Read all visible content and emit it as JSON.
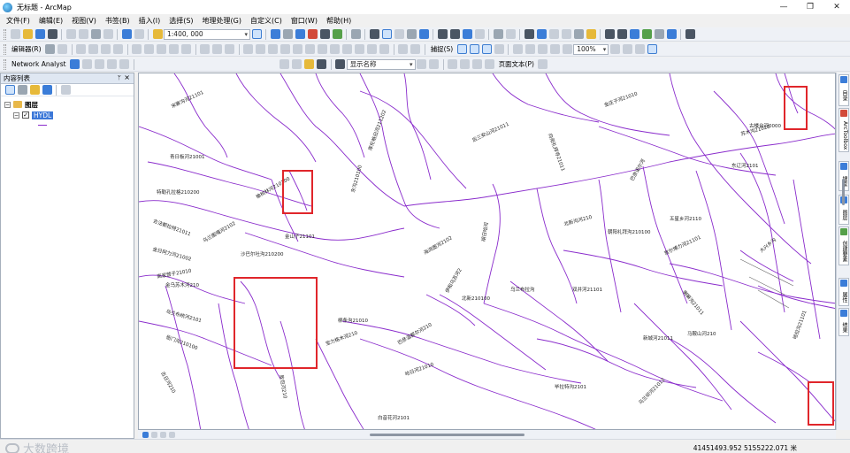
{
  "window": {
    "title": "无标题 - ArcMap",
    "minimize": "—",
    "restore": "❐",
    "close": "✕"
  },
  "menu": [
    "文件(F)",
    "编辑(E)",
    "视图(V)",
    "书签(B)",
    "插入(I)",
    "选择(S)",
    "地理处理(G)",
    "自定义(C)",
    "窗口(W)",
    "帮助(H)"
  ],
  "toolbar": {
    "scale": "1:400, 000",
    "editor": "编辑器(R)",
    "snapping": "捕捉(S)",
    "network_analyst": "Network Analyst",
    "display_name": "显示名称",
    "page_text": "页面文本(P)",
    "zoom_percent": "100%"
  },
  "toc": {
    "title": "内容列表",
    "pin": "ᛘ",
    "close": "×",
    "group": "图层",
    "layer": "HYDL",
    "expand": "−",
    "check": "✓"
  },
  "map": {
    "labels": [
      "宋寨沟河21101",
      "库伦格旧河211202",
      "古楼台河0000",
      "金庄子河21010",
      "后三安山河21011",
      "向阳礼拜寺21011",
      "青日板河21001",
      "特勒孔拉格210200",
      "合法都拉特21011",
      "乌兰图嘎河2102",
      "金山子21101",
      "金日阿力河21002",
      "高家营子21010",
      "北新210100",
      "金乌苏木河210",
      "北新沟河210",
      "沙巴尔吐沟210200",
      "朝阳礼拜沟210100",
      "东辽河2101",
      "宫尔博力河21101",
      "五星乡河2110",
      "乌兰布拉沟",
      "宝力格木河210",
      "柳条沟21010",
      "巴彦温都尔河210",
      "海流图河2102",
      "毕拉特沟2101",
      "新城河21011",
      "大兴乡沟",
      "白音花河2101",
      "衙门沟210100",
      "乌兰布统河2101",
      "榆树林河210100",
      "喇嘛沟21011",
      "马鞍山河210",
      "苏木沟21020",
      "双井河21101",
      "伊和乌苏河2",
      "巴彦诺尔河",
      "胡日哈河",
      "乌兰坝河21012",
      "哈日河21010",
      "哈拉沟21101",
      "东沟210100",
      "敖包河210",
      "古日河210"
    ]
  },
  "dock": [
    "目录",
    "ArcToolbox",
    "搜索",
    "图层",
    "创建要素",
    "属性",
    "结果"
  ],
  "status": {
    "coords": "41451493.952  5155222.071 米",
    "watermark": "大数跨境"
  }
}
